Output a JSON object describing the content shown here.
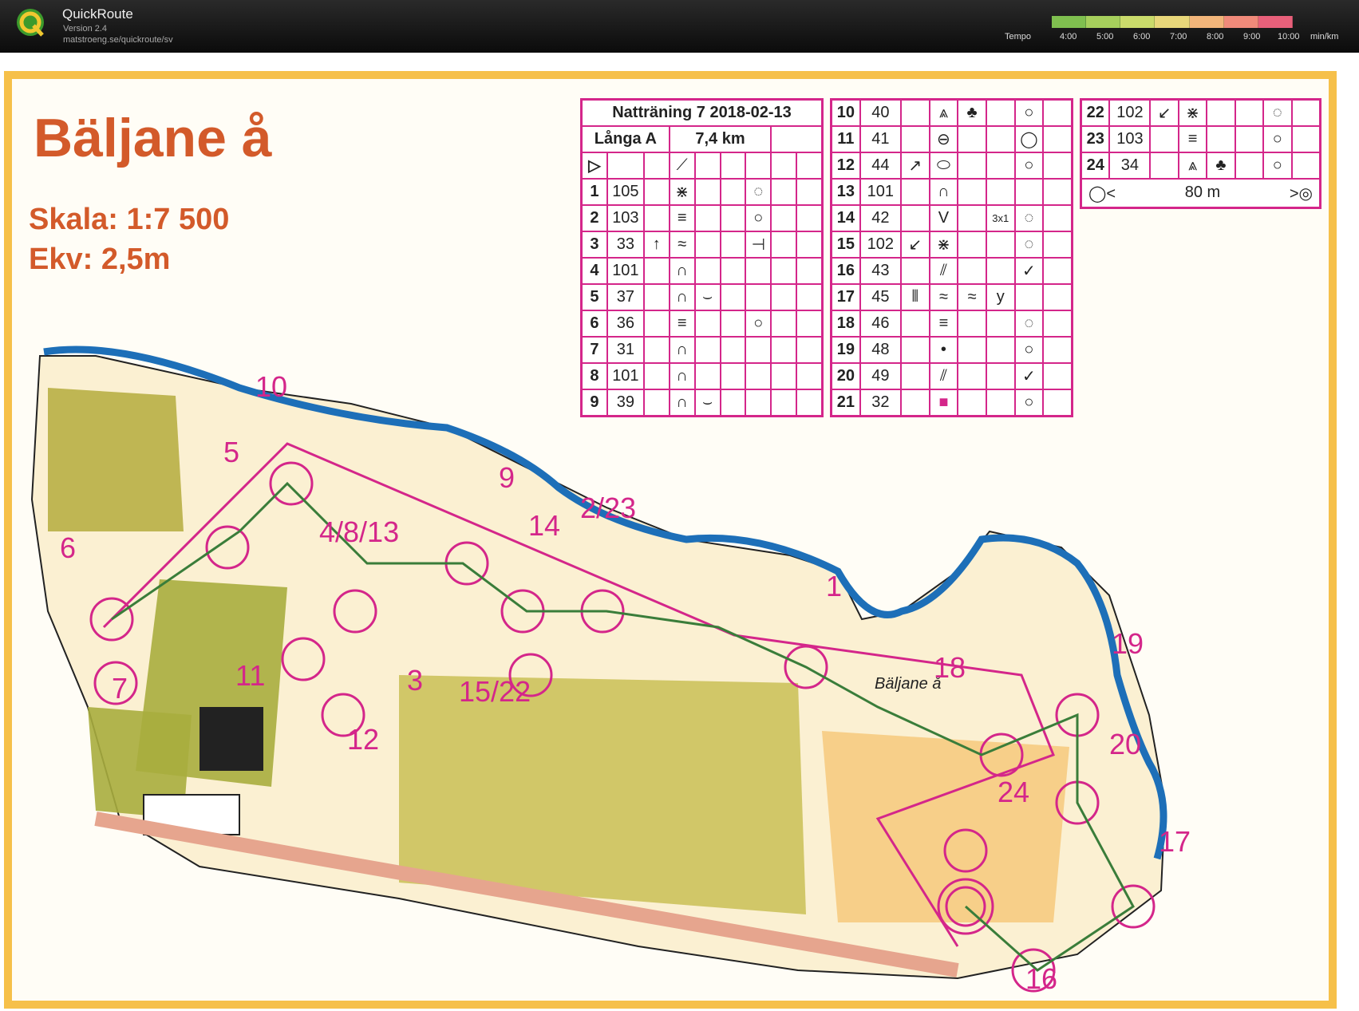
{
  "app": {
    "name": "QuickRoute",
    "version": "Version 2.4",
    "url": "matstroeng.se/quickroute/sv",
    "tempo_label": "Tempo",
    "tempo_ticks": [
      "4:00",
      "5:00",
      "6:00",
      "7:00",
      "8:00",
      "9:00",
      "10:00"
    ],
    "tempo_unit": "min/km",
    "tempo_colors": [
      "#7fbf4f",
      "#a6cf5c",
      "#cadb6b",
      "#e8d77a",
      "#f2b57a",
      "#f08a7a",
      "#e8607a"
    ]
  },
  "map": {
    "title": "Bäljane å",
    "scale": "Skala: 1:7 500",
    "contour": "Ekv: 2,5m",
    "river_label": "Bäljane å",
    "colors": {
      "border": "#f6c04a",
      "magenta": "#d4268a",
      "title": "#d35a2a",
      "river": "#1d6fb8",
      "green": "#a9ad3e"
    },
    "control_labels": [
      "10",
      "5",
      "9",
      "4/8/13",
      "14",
      "2/23",
      "1",
      "6",
      "11",
      "3",
      "15/22",
      "12",
      "7",
      "18",
      "19",
      "24",
      "20",
      "17",
      "16"
    ]
  },
  "description": {
    "event": "Natträning 7 2018-02-13",
    "course": "Långa A",
    "length": "7,4 km",
    "table1": [
      {
        "n": "1",
        "code": "105"
      },
      {
        "n": "2",
        "code": "103"
      },
      {
        "n": "3",
        "code": "33"
      },
      {
        "n": "4",
        "code": "101"
      },
      {
        "n": "5",
        "code": "37"
      },
      {
        "n": "6",
        "code": "36"
      },
      {
        "n": "7",
        "code": "31"
      },
      {
        "n": "8",
        "code": "101"
      },
      {
        "n": "9",
        "code": "39"
      }
    ],
    "table2": [
      {
        "n": "10",
        "code": "40",
        "extra": ""
      },
      {
        "n": "11",
        "code": "41",
        "extra": ""
      },
      {
        "n": "12",
        "code": "44",
        "extra": ""
      },
      {
        "n": "13",
        "code": "101",
        "extra": ""
      },
      {
        "n": "14",
        "code": "42",
        "extra": "3x1"
      },
      {
        "n": "15",
        "code": "102",
        "extra": ""
      },
      {
        "n": "16",
        "code": "43",
        "extra": ""
      },
      {
        "n": "17",
        "code": "45",
        "extra": ""
      },
      {
        "n": "18",
        "code": "46",
        "extra": ""
      },
      {
        "n": "19",
        "code": "48",
        "extra": ""
      },
      {
        "n": "20",
        "code": "49",
        "extra": ""
      },
      {
        "n": "21",
        "code": "32",
        "extra": ""
      }
    ],
    "table3": [
      {
        "n": "22",
        "code": "102"
      },
      {
        "n": "23",
        "code": "103"
      },
      {
        "n": "24",
        "code": "34"
      }
    ],
    "finish_distance": "80 m"
  }
}
